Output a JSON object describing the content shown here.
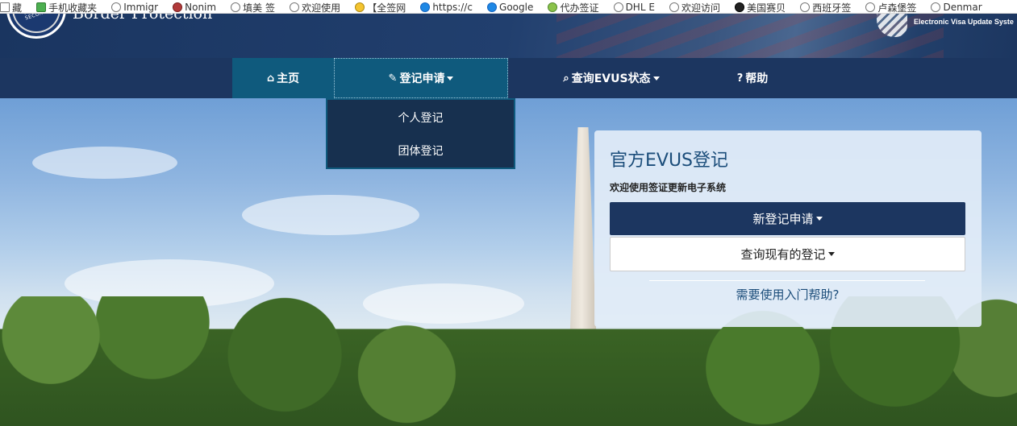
{
  "bookmarks": [
    {
      "label": "藏",
      "icon": "folder-icon"
    },
    {
      "label": "手机收藏夹",
      "icon": "phone-icon"
    },
    {
      "label": "Immigr",
      "icon": "globe-icon"
    },
    {
      "label": "Nonim",
      "icon": "seal-icon"
    },
    {
      "label": "填美 签",
      "icon": "globe-icon"
    },
    {
      "label": "欢迎使用",
      "icon": "globe-icon"
    },
    {
      "label": "【全签网",
      "icon": "q-icon"
    },
    {
      "label": "https://c",
      "icon": "cloud-icon"
    },
    {
      "label": "Google",
      "icon": "google-icon"
    },
    {
      "label": "代办签证",
      "icon": "leaf-icon"
    },
    {
      "label": "DHL E",
      "icon": "globe-icon"
    },
    {
      "label": "欢迎访问",
      "icon": "globe-icon"
    },
    {
      "label": "美国赛贝",
      "icon": "badge-icon"
    },
    {
      "label": "西班牙签",
      "icon": "globe-icon"
    },
    {
      "label": "卢森堡签",
      "icon": "globe-icon"
    },
    {
      "label": "Denmar",
      "icon": "globe-icon"
    }
  ],
  "header": {
    "agency": "Border Protection",
    "seal_text": "OMELAND SECURITY",
    "evus_tagline": "Electronic Visa Update Syste"
  },
  "nav": {
    "home": "主页",
    "register": "登记申请",
    "query": "查询EVUS状态",
    "help": "帮助"
  },
  "dropdown": {
    "items": [
      "个人登记",
      "团体登记"
    ]
  },
  "panel": {
    "title": "官方EVUS登记",
    "subtitle": "欢迎使用签证更新电子系统",
    "new_button": "新登记申请",
    "query_button": "查询现有的登记",
    "help_link": "需要使用入门帮助?"
  },
  "colors": {
    "nav_bg": "#1c3660",
    "nav_active": "#0f5a7d",
    "panel_bg": "#e1ecf7",
    "link": "#1b4d7a"
  }
}
